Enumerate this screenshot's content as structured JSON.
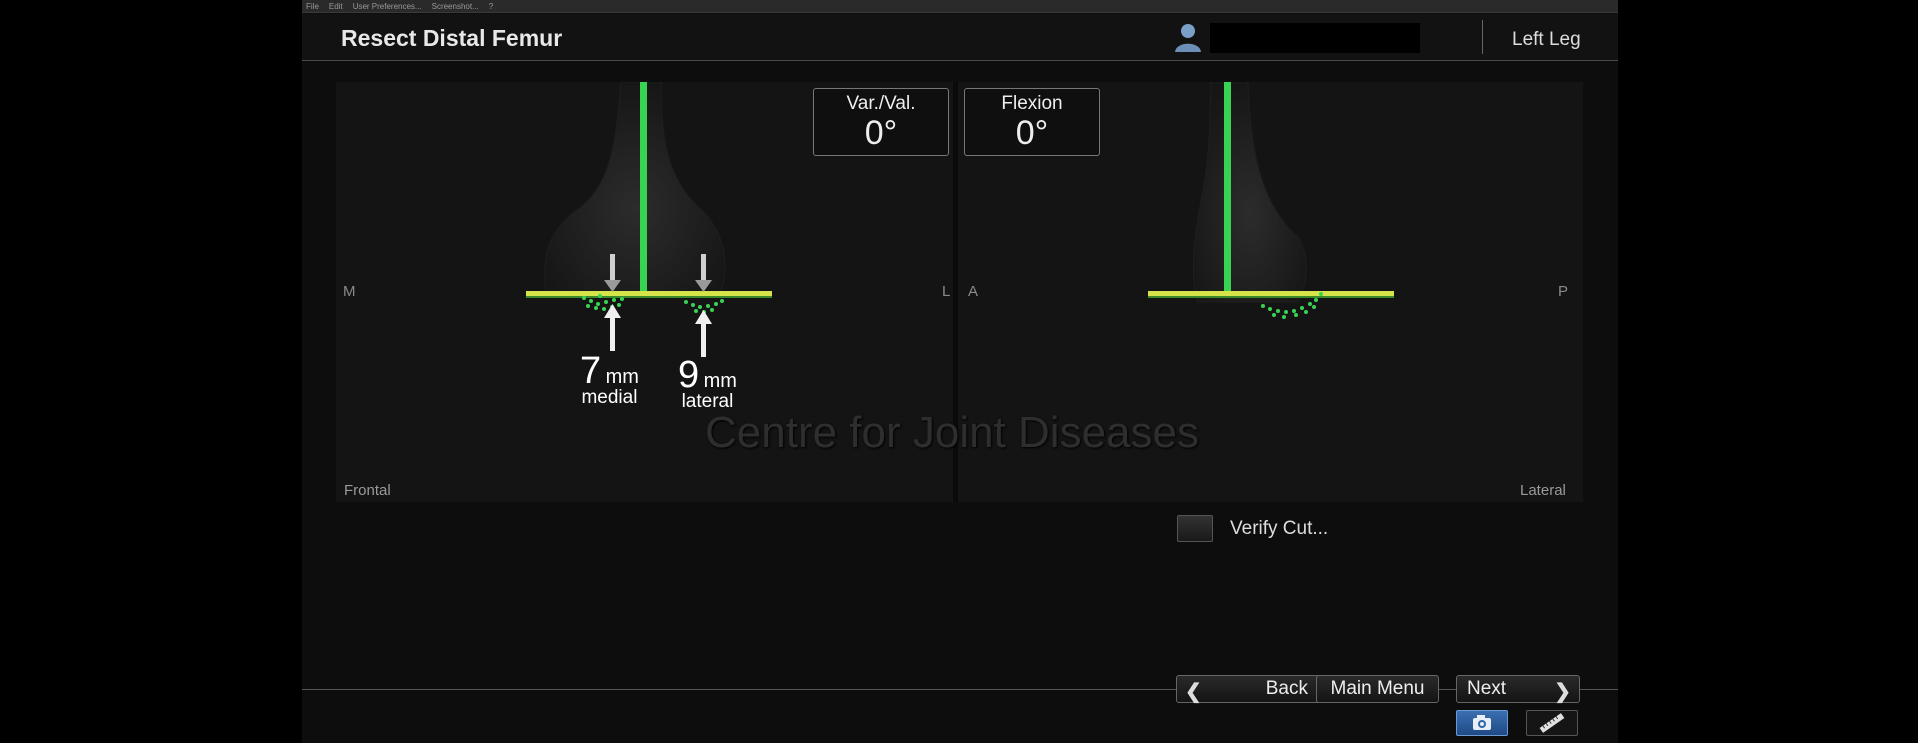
{
  "menubar": [
    "File",
    "Edit",
    "User Preferences...",
    "Screenshot...",
    "?"
  ],
  "header": {
    "title": "Resect Distal Femur",
    "user_icon": "user-icon",
    "leg": "Left Leg"
  },
  "frontal_view": {
    "label": "Frontal",
    "left_axis": "M",
    "right_axis": "L",
    "medial": {
      "value": "7",
      "unit": "mm",
      "side": "medial"
    },
    "lateral": {
      "value": "9",
      "unit": "mm",
      "side": "lateral"
    }
  },
  "lateral_view": {
    "label": "Lateral",
    "left_axis": "A",
    "right_axis": "P"
  },
  "readouts": [
    {
      "label": "Var./Val.",
      "value": "0°"
    },
    {
      "label": "Flexion",
      "value": "0°"
    }
  ],
  "watermark": "Centre for Joint Diseases",
  "verify_cut": {
    "label": "Verify Cut..."
  },
  "nav": {
    "back": "Back",
    "main_menu": "Main Menu",
    "next": "Next"
  },
  "tools": {
    "camera_icon": "camera-icon",
    "ruler_icon": "ruler-icon"
  },
  "colors": {
    "accent_green": "#39d353",
    "cut_plane_yellow": "#d7e34a",
    "camera_blue": "#2f64a8"
  }
}
